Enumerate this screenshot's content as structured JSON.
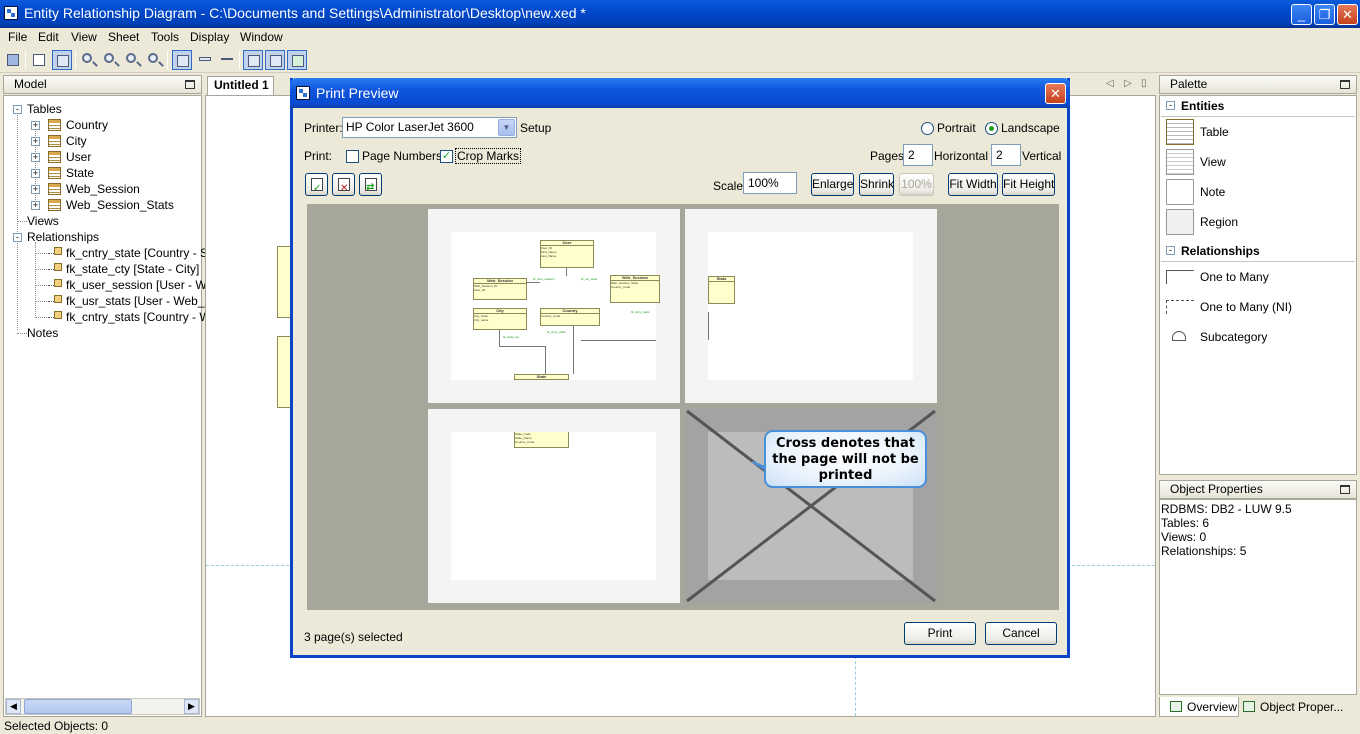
{
  "window": {
    "title": "Entity Relationship Diagram - C:\\Documents and Settings\\Administrator\\Desktop\\new.xed *",
    "minimize": "_",
    "restore": "❐",
    "close": "✕"
  },
  "menu": [
    "File",
    "Edit",
    "View",
    "Sheet",
    "Tools",
    "Display",
    "Window"
  ],
  "model_panel": {
    "title": "Model",
    "tables_label": "Tables",
    "tables": [
      "Country",
      "City",
      "User",
      "State",
      "Web_Session",
      "Web_Session_Stats"
    ],
    "views_label": "Views",
    "relationships_label": "Relationships",
    "relationships": [
      "fk_cntry_state [Country - St",
      "fk_state_cty [State - City]",
      "fk_user_session [User - Web",
      "fk_usr_stats [User - Web_Se",
      "fk_cntry_stats [Country - W"
    ],
    "notes_label": "Notes",
    "expand_plus": "+",
    "expand_minus": "-"
  },
  "editor": {
    "tab": "Untitled 1",
    "nav_left": "◁",
    "nav_right": "▷",
    "nav_menu": "▯"
  },
  "palette": {
    "title": "Palette",
    "entities_label": "Entities",
    "entities": [
      "Table",
      "View",
      "Note",
      "Region"
    ],
    "relationships_label": "Relationships",
    "relationships": [
      "One to Many",
      "One to Many (NI)",
      "Subcategory"
    ],
    "collapse": "-"
  },
  "object_properties": {
    "title": "Object Properties",
    "lines": [
      "RDBMS: DB2 - LUW 9.5",
      "Tables: 6",
      "Views: 0",
      "Relationships: 5"
    ],
    "tab_overview": "Overview",
    "tab_properties": "Object Proper..."
  },
  "status_bar": {
    "text": "Selected Objects: 0"
  },
  "print_preview": {
    "title": "Print Preview",
    "close": "✕",
    "printer_label": "Printer:",
    "printer_value": "HP Color LaserJet 3600",
    "setup_label": "Setup",
    "portrait_label": "Portrait",
    "landscape_label": "Landscape",
    "orientation_selected": "Landscape",
    "print_label": "Print:",
    "page_numbers_label": "Page Numbers",
    "page_numbers_checked": false,
    "crop_marks_label": "Crop Marks",
    "crop_marks_checked": true,
    "pages_label": "Pages:",
    "pages_horizontal": "2",
    "horizontal_label": "Horizontal",
    "pages_vertical": "2",
    "vertical_label": "Vertical",
    "scale_label": "Scale:",
    "scale_value": "100%",
    "enlarge_label": "Enlarge",
    "shrink_label": "Shrink",
    "hundred_label": "100%",
    "fit_width_label": "Fit Width",
    "fit_height_label": "Fit Height",
    "callout": "Cross denotes that the page will not be printed",
    "status": "3 page(s) selected",
    "print_button": "Print",
    "cancel_button": "Cancel",
    "check_mark": "✓"
  }
}
